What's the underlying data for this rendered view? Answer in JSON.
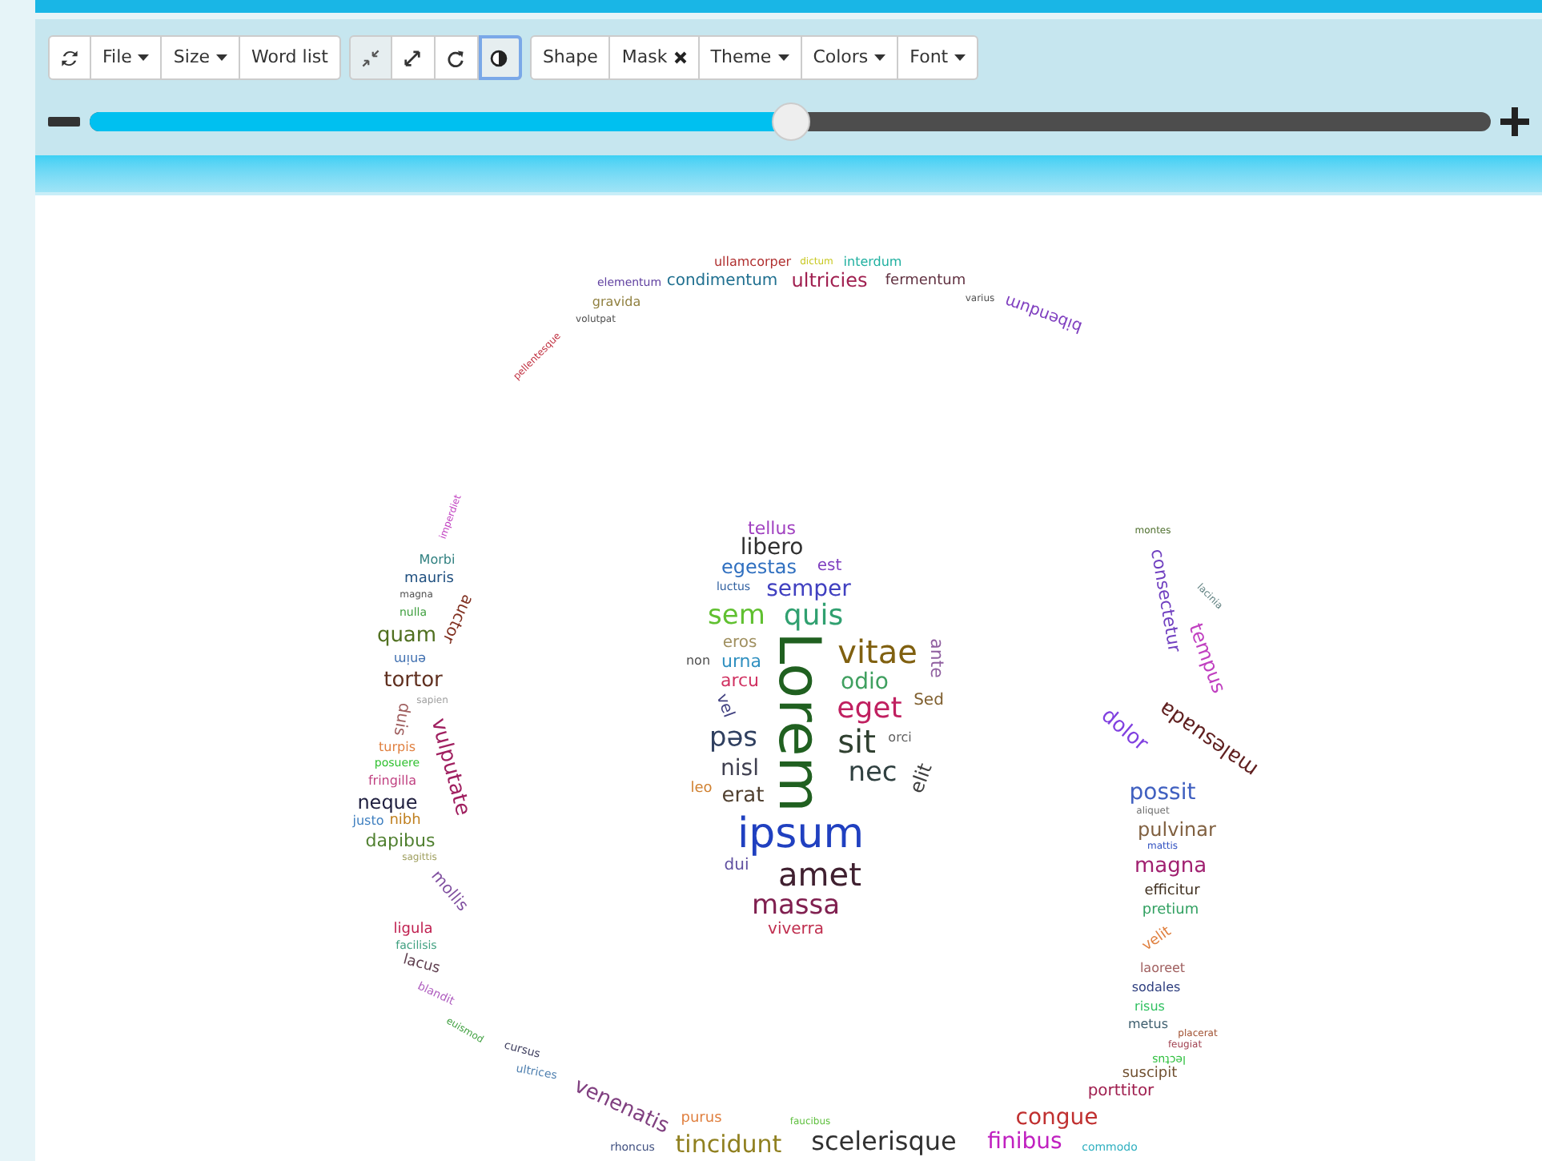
{
  "toolbar": {
    "groups": [
      {
        "buttons": [
          {
            "kind": "icon"
          },
          {
            "kind": "text",
            "label": "File",
            "has_menu": true
          },
          {
            "kind": "text",
            "label": "Size",
            "has_menu": true
          },
          {
            "kind": "text",
            "label": "Word list",
            "has_menu": false
          }
        ]
      },
      {
        "buttons": [
          {
            "kind": "icon",
            "pressed": true
          },
          {
            "kind": "icon",
            "pressed": false
          },
          {
            "kind": "icon",
            "pressed": false
          },
          {
            "kind": "icon",
            "pressed": true,
            "focused": true
          }
        ]
      },
      {
        "buttons": [
          {
            "kind": "text",
            "label": "Shape",
            "has_menu": false
          },
          {
            "kind": "text",
            "label": "Mask",
            "has_menu": false,
            "removable": true
          },
          {
            "kind": "text",
            "label": "Theme",
            "has_menu": true
          },
          {
            "kind": "text",
            "label": "Colors",
            "has_menu": true
          },
          {
            "kind": "text",
            "label": "Font",
            "has_menu": true
          }
        ]
      }
    ]
  },
  "zoom_slider": {
    "level": 0.5
  },
  "word_cloud": {
    "words": [
      {
        "text": "ullamcorper",
        "color": "#b03030"
      },
      {
        "text": "dictum",
        "color": "#c8c820"
      },
      {
        "text": "interdum",
        "color": "#20b0a0"
      },
      {
        "text": "elementum",
        "color": "#6040a0"
      },
      {
        "text": "condimentum",
        "color": "#207090"
      },
      {
        "text": "ultricies",
        "color": "#a02050"
      },
      {
        "text": "fermentum",
        "color": "#603040"
      },
      {
        "text": "gravida",
        "color": "#908040"
      },
      {
        "text": "varius",
        "color": "#505050"
      },
      {
        "text": "bibendum",
        "color": "#8040c0"
      },
      {
        "text": "volutpat",
        "color": "#505050"
      },
      {
        "text": "pellentesque",
        "color": "#c03040"
      },
      {
        "text": "imperdiet",
        "color": "#c040c0"
      },
      {
        "text": "Morbi",
        "color": "#308080"
      },
      {
        "text": "mauris",
        "color": "#205080"
      },
      {
        "text": "magna",
        "color": "#505050"
      },
      {
        "text": "nulla",
        "color": "#40a040"
      },
      {
        "text": "auctor",
        "color": "#803020"
      },
      {
        "text": "quam",
        "color": "#507020"
      },
      {
        "text": "enim",
        "color": "#4070b0"
      },
      {
        "text": "tortor",
        "color": "#603020"
      },
      {
        "text": "sapien",
        "color": "#a0a0a0"
      },
      {
        "text": "duis",
        "color": "#a06060"
      },
      {
        "text": "turpis",
        "color": "#e08040"
      },
      {
        "text": "vulputate",
        "color": "#a02060"
      },
      {
        "text": "posuere",
        "color": "#30c030"
      },
      {
        "text": "fringilla",
        "color": "#c04080"
      },
      {
        "text": "neque",
        "color": "#202040"
      },
      {
        "text": "justo",
        "color": "#4080c0"
      },
      {
        "text": "nibh",
        "color": "#c08020"
      },
      {
        "text": "dapibus",
        "color": "#508030"
      },
      {
        "text": "sagittis",
        "color": "#a0a060"
      },
      {
        "text": "mollis",
        "color": "#8050a0"
      },
      {
        "text": "ligula",
        "color": "#c02050"
      },
      {
        "text": "facilisis",
        "color": "#40a080"
      },
      {
        "text": "lacus",
        "color": "#604050"
      },
      {
        "text": "blandit",
        "color": "#b060c0"
      },
      {
        "text": "euismod",
        "color": "#40a040"
      },
      {
        "text": "tellus",
        "color": "#a040c0"
      },
      {
        "text": "libero",
        "color": "#303030"
      },
      {
        "text": "egestas",
        "color": "#3070c0"
      },
      {
        "text": "est",
        "color": "#8040c0"
      },
      {
        "text": "luctus",
        "color": "#3060a0"
      },
      {
        "text": "semper",
        "color": "#4040c0"
      },
      {
        "text": "sem",
        "color": "#60c030"
      },
      {
        "text": "quis",
        "color": "#30a070"
      },
      {
        "text": "eros",
        "color": "#a09060"
      },
      {
        "text": "non",
        "color": "#505050"
      },
      {
        "text": "urna",
        "color": "#3090c0"
      },
      {
        "text": "vitae",
        "color": "#806010"
      },
      {
        "text": "ante",
        "color": "#9060a0"
      },
      {
        "text": "arcu",
        "color": "#d03060"
      },
      {
        "text": "odio",
        "color": "#40a060"
      },
      {
        "text": "vel",
        "color": "#404080"
      },
      {
        "text": "Lorem",
        "color": "#206020"
      },
      {
        "text": "eget",
        "color": "#c02060"
      },
      {
        "text": "Sed",
        "color": "#806030"
      },
      {
        "text": "sed",
        "color": "#304060"
      },
      {
        "text": "sit",
        "color": "#304030"
      },
      {
        "text": "orci",
        "color": "#606060"
      },
      {
        "text": "nisl",
        "color": "#404050"
      },
      {
        "text": "nec",
        "color": "#304040"
      },
      {
        "text": "elit",
        "color": "#404040"
      },
      {
        "text": "leo",
        "color": "#d08030"
      },
      {
        "text": "erat",
        "color": "#504030"
      },
      {
        "text": "ipsum",
        "color": "#2040c0"
      },
      {
        "text": "dui",
        "color": "#6050a0"
      },
      {
        "text": "amet",
        "color": "#402030"
      },
      {
        "text": "massa",
        "color": "#802050"
      },
      {
        "text": "viverra",
        "color": "#c03050"
      },
      {
        "text": "montes",
        "color": "#507030"
      },
      {
        "text": "consectetur",
        "color": "#7040c0"
      },
      {
        "text": "lacinia",
        "color": "#608080"
      },
      {
        "text": "tempus",
        "color": "#c040c0"
      },
      {
        "text": "dolor",
        "color": "#8040e0"
      },
      {
        "text": "malesuada",
        "color": "#602020"
      },
      {
        "text": "possit",
        "color": "#4060c0"
      },
      {
        "text": "aliquet",
        "color": "#707070"
      },
      {
        "text": "pulvinar",
        "color": "#806040"
      },
      {
        "text": "mattis",
        "color": "#3050c0"
      },
      {
        "text": "magna",
        "color": "#a02070"
      },
      {
        "text": "efficitur",
        "color": "#403020"
      },
      {
        "text": "pretium",
        "color": "#30a060"
      },
      {
        "text": "velit",
        "color": "#e08040"
      },
      {
        "text": "laoreet",
        "color": "#a06060"
      },
      {
        "text": "sodales",
        "color": "#304080"
      },
      {
        "text": "risus",
        "color": "#30c060"
      },
      {
        "text": "metus",
        "color": "#406070"
      },
      {
        "text": "placerat",
        "color": "#a05030"
      },
      {
        "text": "feugiat",
        "color": "#a04050"
      },
      {
        "text": "cursus",
        "color": "#404060"
      },
      {
        "text": "lectus",
        "color": "#30c040"
      },
      {
        "text": "ultrices",
        "color": "#5080b0"
      },
      {
        "text": "suscipit",
        "color": "#705030"
      },
      {
        "text": "porttitor",
        "color": "#a02050"
      },
      {
        "text": "venenatis",
        "color": "#804080"
      },
      {
        "text": "purus",
        "color": "#e08040"
      },
      {
        "text": "faucibus",
        "color": "#60c040"
      },
      {
        "text": "congue",
        "color": "#c03030"
      },
      {
        "text": "rhoncus",
        "color": "#405080"
      },
      {
        "text": "tincidunt",
        "color": "#908020"
      },
      {
        "text": "scelerisque",
        "color": "#303030"
      },
      {
        "text": "finibus",
        "color": "#c020c0"
      },
      {
        "text": "commodo",
        "color": "#30b0c0"
      }
    ]
  }
}
